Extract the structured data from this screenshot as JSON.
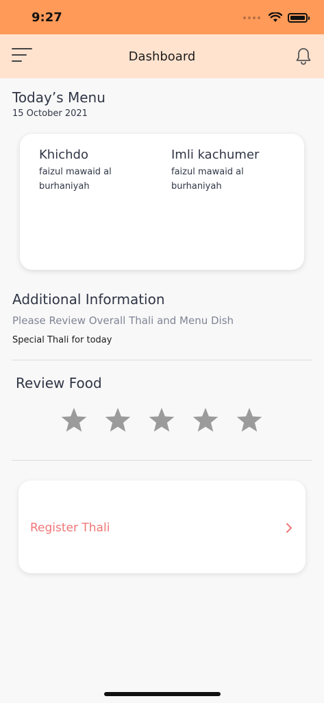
{
  "status": {
    "time": "9:27"
  },
  "header": {
    "title": "Dashboard"
  },
  "menu": {
    "title": "Today’s Menu",
    "date": "15 October 2021",
    "dishes": [
      {
        "name": "Khichdo",
        "source": "faizul mawaid al burhaniyah"
      },
      {
        "name": "Imli kachumer",
        "source": "faizul mawaid al burhaniyah"
      }
    ]
  },
  "additional": {
    "title": "Additional Information",
    "subtitle": "Please Review Overall Thali and Menu Dish",
    "note": "Special Thali for today"
  },
  "review": {
    "title": "Review Food",
    "rating": 0,
    "max_rating": 5
  },
  "register": {
    "label": "Register Thali"
  },
  "colors": {
    "status_bar": "#ff9a58",
    "header_bg": "#ffe3cf",
    "accent": "#ef7676",
    "star_inactive": "#9b9b9b"
  },
  "icons": {
    "menu": "hamburger-menu-icon",
    "notification": "bell-icon",
    "star": "star-icon",
    "chevron": "chevron-right-icon"
  }
}
